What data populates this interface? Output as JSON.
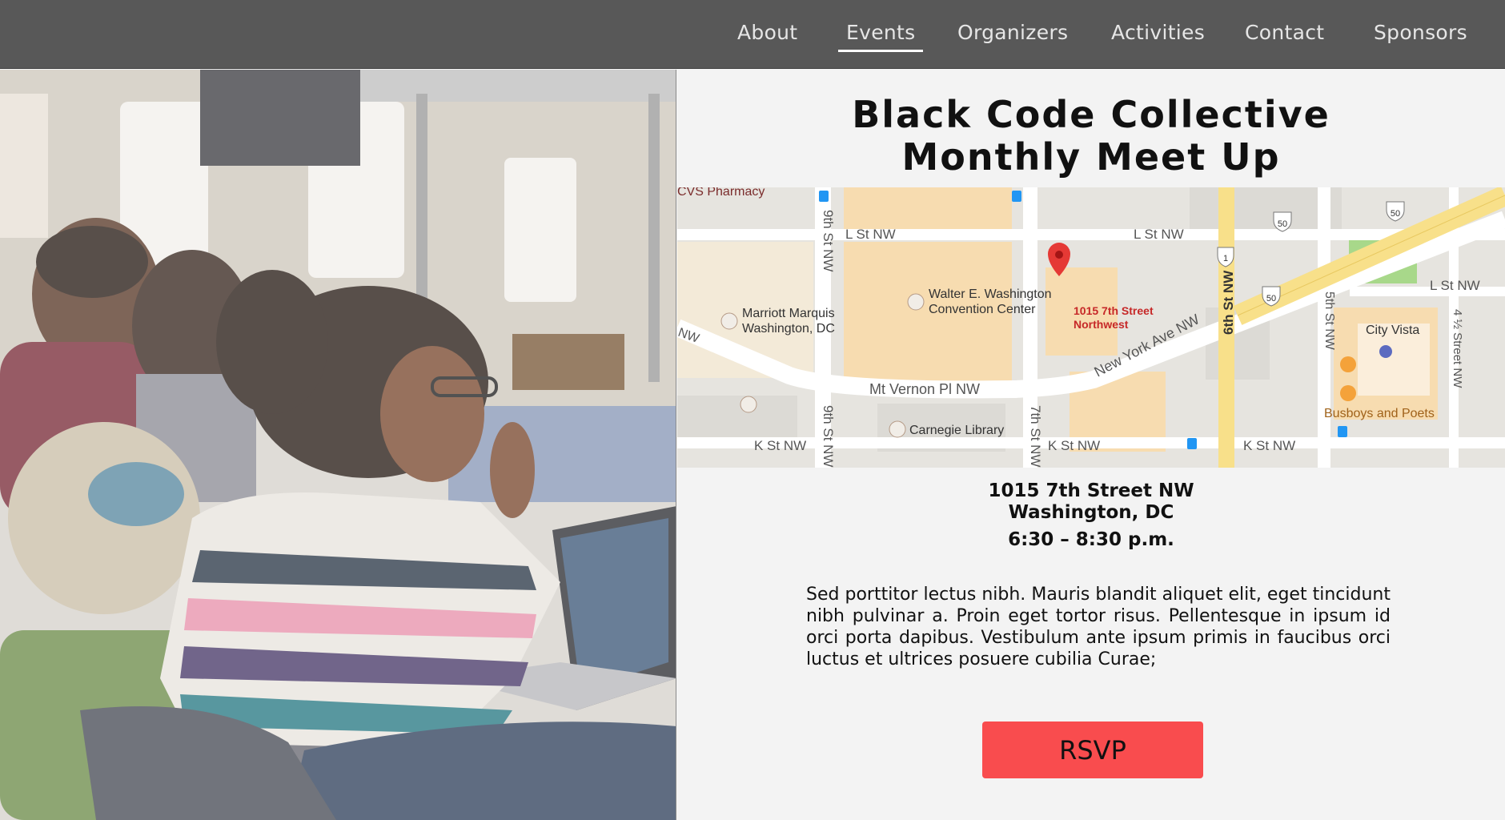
{
  "nav": {
    "items": [
      {
        "label": "About"
      },
      {
        "label": "Events",
        "active": true
      },
      {
        "label": "Organizers"
      },
      {
        "label": "Activities"
      },
      {
        "label": "Contact"
      },
      {
        "label": "Sponsors"
      }
    ]
  },
  "event": {
    "title_line1": "Black Code Collective",
    "title_line2": "Monthly Meet Up",
    "address_line1": "1015 7th Street NW",
    "address_line2": "Washington, DC",
    "time": "6:30 – 8:30 p.m.",
    "description": "Sed porttitor lectus nibh. Mauris blandit aliquet elit, eget tincidunt nibh pulvinar a. Proin eget tortor risus. Pellentesque in ipsum id orci porta dapibus. Vestibulum ante ipsum primis in faucibus orci luctus et ultrices posuere cubilia Curae;",
    "rsvp_label": "RSVP"
  },
  "map": {
    "streets": {
      "l_st_left": "L St NW",
      "l_st_mid": "L St NW",
      "l_st_right": "L St NW",
      "k_st_left": "K St NW",
      "k_st_mid": "K St NW",
      "k_st_right": "K St NW",
      "ninth_top": "9th St NW",
      "ninth_bottom": "9th St NW",
      "seventh": "7th St NW",
      "sixth": "6th St NW",
      "fifth": "5th St NW",
      "four_half": "4 ½ Street NW",
      "mt_vernon": "Mt Vernon Pl NW",
      "new_york": "New York Ave NW",
      "nw_fragment": "NW"
    },
    "places": {
      "cvs": "CVS Pharmacy",
      "marriott_1": "Marriott Marquis",
      "marriott_2": "Washington, DC",
      "convention_1": "Walter E. Washington",
      "convention_2": "Convention Center",
      "carnegie": "Carnegie Library",
      "city_vista": "City Vista",
      "busboys": "Busboys and Poets",
      "pin_1": "1015 7th Street",
      "pin_2": "Northwest"
    },
    "shields": {
      "us50": "50",
      "us1": "1"
    },
    "colors": {
      "highway": "#f8e08a",
      "block": "#f7dcb0",
      "park": "#a8d88a",
      "pin": "#e53935",
      "pin_label": "#c62828"
    }
  },
  "colors": {
    "navbar": "#585858",
    "rsvp": "#f94c4e"
  }
}
